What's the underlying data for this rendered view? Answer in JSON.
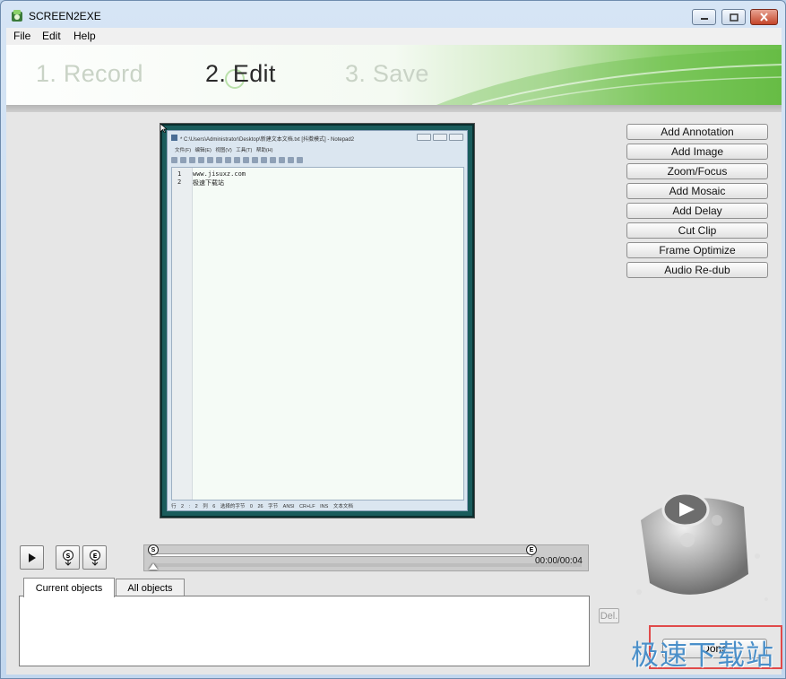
{
  "window": {
    "title": "SCREEN2EXE"
  },
  "menu": {
    "items": [
      "File",
      "Edit",
      "Help"
    ]
  },
  "steps": [
    {
      "label": "1. Record",
      "state": "inactive"
    },
    {
      "label": "2. Edit",
      "state": "active"
    },
    {
      "label": "3. Save",
      "state": "inactive"
    }
  ],
  "preview": {
    "notepad_title": "* C:\\Users\\Administrator\\Desktop\\新建文本文档.txt [抖擞模式] - Notepad2",
    "notepad_menu": "文件(F) 编辑(E) 视图(V) 工具(T) 帮助(H)",
    "lines": [
      {
        "num": "1",
        "text": "www.jisuxz.com"
      },
      {
        "num": "2",
        "text": "极速下载站"
      }
    ],
    "status": "行 2 : 2   列 6   选择的字节 0        26 字节        ANSI        CR+LF  INS   文本文档"
  },
  "actions": [
    "Add Annotation",
    "Add Image",
    "Zoom/Focus",
    "Add Mosaic",
    "Add Delay",
    "Cut Clip",
    "Frame Optimize",
    "Audio Re-dub"
  ],
  "playback": {
    "start_marker": "S",
    "end_marker": "E",
    "time": "00:00/00:04"
  },
  "tabs": {
    "current": "Current objects",
    "all": "All objects"
  },
  "buttons": {
    "del": "Del.",
    "done": "Done"
  },
  "watermark": "极速下载站",
  "colors": {
    "accent_green": "#6bbf4a",
    "watermark_red": "#e04a4a",
    "watermark_blue": "#4a8fc9",
    "preview_bg": "#1a5c5c"
  }
}
